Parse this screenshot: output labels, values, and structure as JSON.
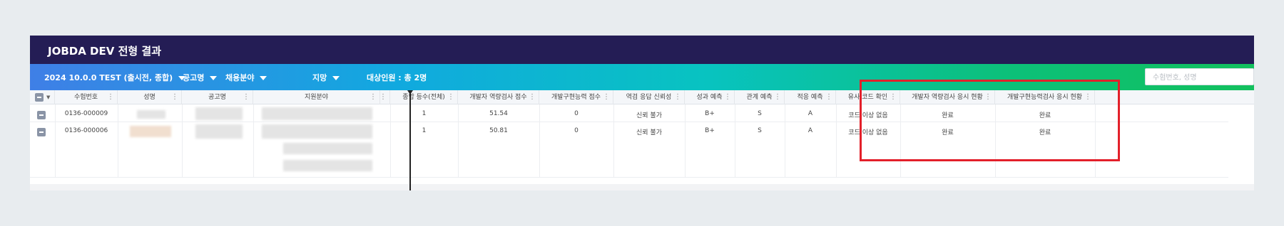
{
  "title": "JOBDA DEV 전형 결과",
  "filters": {
    "exam": "2024 10.0.0 TEST (출시전, 종합)",
    "posting": "공고명",
    "category": "채용분야",
    "preference": "지망",
    "target": "대상인원 : 총 2명"
  },
  "search": {
    "placeholder": "수험번호, 성명"
  },
  "columns": [
    "수험번호",
    "성명",
    "공고명",
    "지원분야",
    "종합 등수(전체)",
    "개발자 역량검사 점수",
    "개발구현능력 점수",
    "역검 응답 신뢰성",
    "성과 예측",
    "관계 예측",
    "적응 예측",
    "유사 코드 확인",
    "개발자 역량검사 응시 현황",
    "개발구현능력검사 응시 현황"
  ],
  "rows": [
    {
      "id": "0136-000009",
      "rank": "1",
      "dev_score": "51.54",
      "impl_score": "0",
      "reliability": "신뢰 불가",
      "performance": "B+",
      "relation": "S",
      "adaptation": "A",
      "similar_code": "코드 이상 없음",
      "dev_status": "완료",
      "impl_status": "완료"
    },
    {
      "id": "0136-000006",
      "rank": "1",
      "dev_score": "50.81",
      "impl_score": "0",
      "reliability": "신뢰 불가",
      "performance": "B+",
      "relation": "S",
      "adaptation": "A",
      "similar_code": "코드 이상 없음",
      "dev_status": "완료",
      "impl_status": "완료"
    }
  ],
  "icons": {
    "caret": "caret-down-icon",
    "kebab": "kebab-menu-icon",
    "checkbox": "minus-checkbox-icon"
  },
  "colors": {
    "titlebar": "#241d55",
    "highlight": "#e3202a",
    "gradient_start": "#3f7fe6",
    "gradient_end": "#12c05d"
  }
}
